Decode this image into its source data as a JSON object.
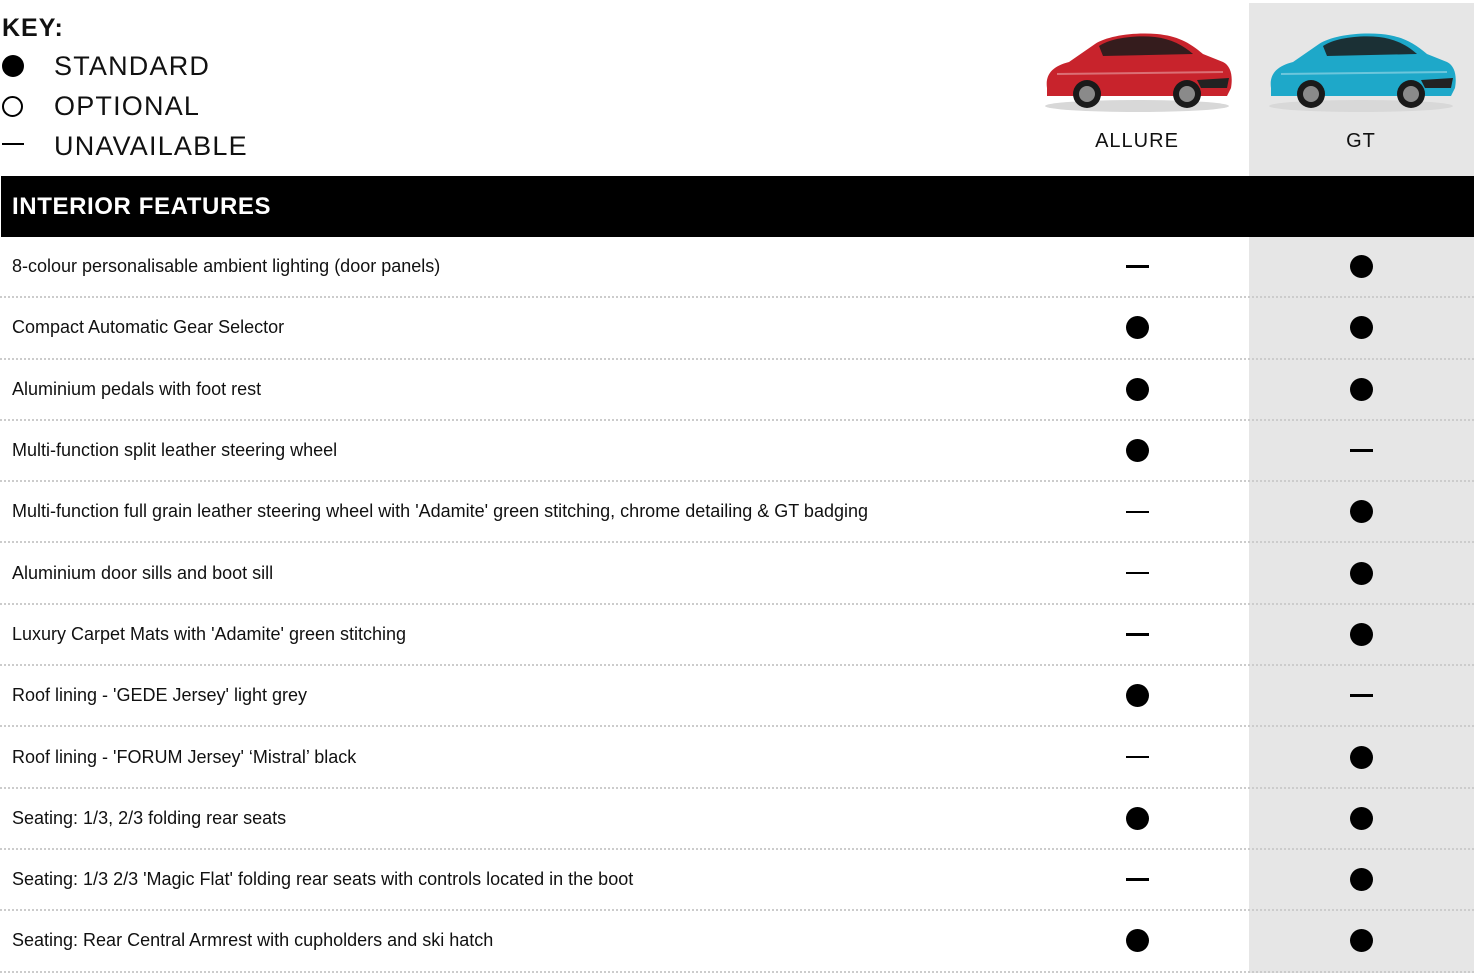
{
  "key": {
    "title": "KEY:",
    "items": [
      {
        "symbol": "filled-circle",
        "label": "STANDARD"
      },
      {
        "symbol": "open-circle",
        "label": "OPTIONAL"
      },
      {
        "symbol": "dash",
        "label": "UNAVAILABLE"
      }
    ]
  },
  "models": [
    {
      "name": "ALLURE",
      "car_color": "#c8232c"
    },
    {
      "name": "GT",
      "car_color": "#1ea8c9"
    }
  ],
  "highlight_color": "#e6e6e6",
  "section": {
    "title": "INTERIOR FEATURES"
  },
  "features": [
    {
      "label": "8-colour personalisable ambient lighting (door panels)",
      "allure": "unavailable",
      "gt": "standard"
    },
    {
      "label": "Compact Automatic Gear Selector",
      "allure": "standard",
      "gt": "standard"
    },
    {
      "label": "Aluminium pedals with foot rest",
      "allure": "standard",
      "gt": "standard"
    },
    {
      "label": "Multi-function split leather steering wheel",
      "allure": "standard",
      "gt": "unavailable"
    },
    {
      "label": "Multi-function full grain leather steering wheel with 'Adamite' green stitching, chrome detailing & GT badging",
      "allure": "unavailable",
      "gt": "standard"
    },
    {
      "label": "Aluminium door sills and boot sill",
      "allure": "unavailable",
      "gt": "standard"
    },
    {
      "label": "Luxury Carpet Mats with 'Adamite' green stitching",
      "allure": "unavailable",
      "gt": "standard"
    },
    {
      "label": "Roof lining - 'GEDE Jersey' light grey",
      "allure": "standard",
      "gt": "unavailable"
    },
    {
      "label": "Roof lining - 'FORUM Jersey' ‘Mistral’ black",
      "allure": "unavailable",
      "gt": "standard"
    },
    {
      "label": "Seating: 1/3, 2/3 folding rear seats",
      "allure": "standard",
      "gt": "standard"
    },
    {
      "label": "Seating: 1/3 2/3 'Magic Flat' folding rear seats with controls located in the boot",
      "allure": "unavailable",
      "gt": "standard"
    },
    {
      "label": "Seating: Rear Central Armrest with cupholders and ski hatch",
      "allure": "standard",
      "gt": "standard"
    }
  ]
}
